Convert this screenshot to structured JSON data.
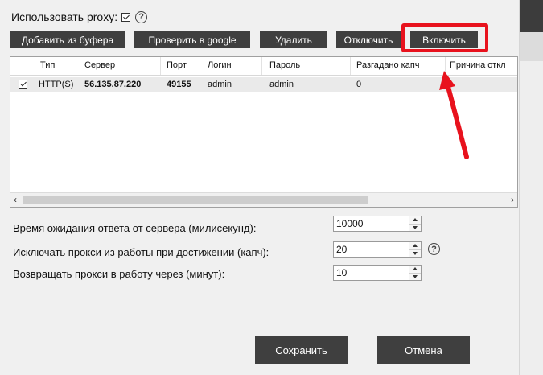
{
  "use_proxy": {
    "label": "Использовать proxy:",
    "checked": true
  },
  "toolbar": {
    "add_from_buffer": "Добавить из буфера",
    "check_google": "Проверить в google",
    "delete": "Удалить",
    "disable": "Отключить",
    "enable": "Включить"
  },
  "table": {
    "columns": [
      "Тип",
      "Сервер",
      "Порт",
      "Логин",
      "Пароль",
      "Разгадано капч",
      "Причина откл"
    ],
    "rows": [
      {
        "checked": true,
        "type": "HTTP(S)",
        "server": "56.135.87.220",
        "port": "49155",
        "login": "admin",
        "password": "admin",
        "solved": "0",
        "reason": ""
      }
    ]
  },
  "settings": {
    "timeout_label": "Время ожидания ответа от сервера (милисекунд):",
    "timeout_value": "10000",
    "exclude_label": "Исключать прокси из работы при достижении (капч):",
    "exclude_value": "20",
    "return_label": "Возвращать прокси в работу через (минут):",
    "return_value": "10"
  },
  "footer": {
    "save": "Сохранить",
    "cancel": "Отмена"
  },
  "colors": {
    "button_bg": "#3f3f3f",
    "highlight": "#e8121d",
    "selected_row": "#eaeaea"
  }
}
